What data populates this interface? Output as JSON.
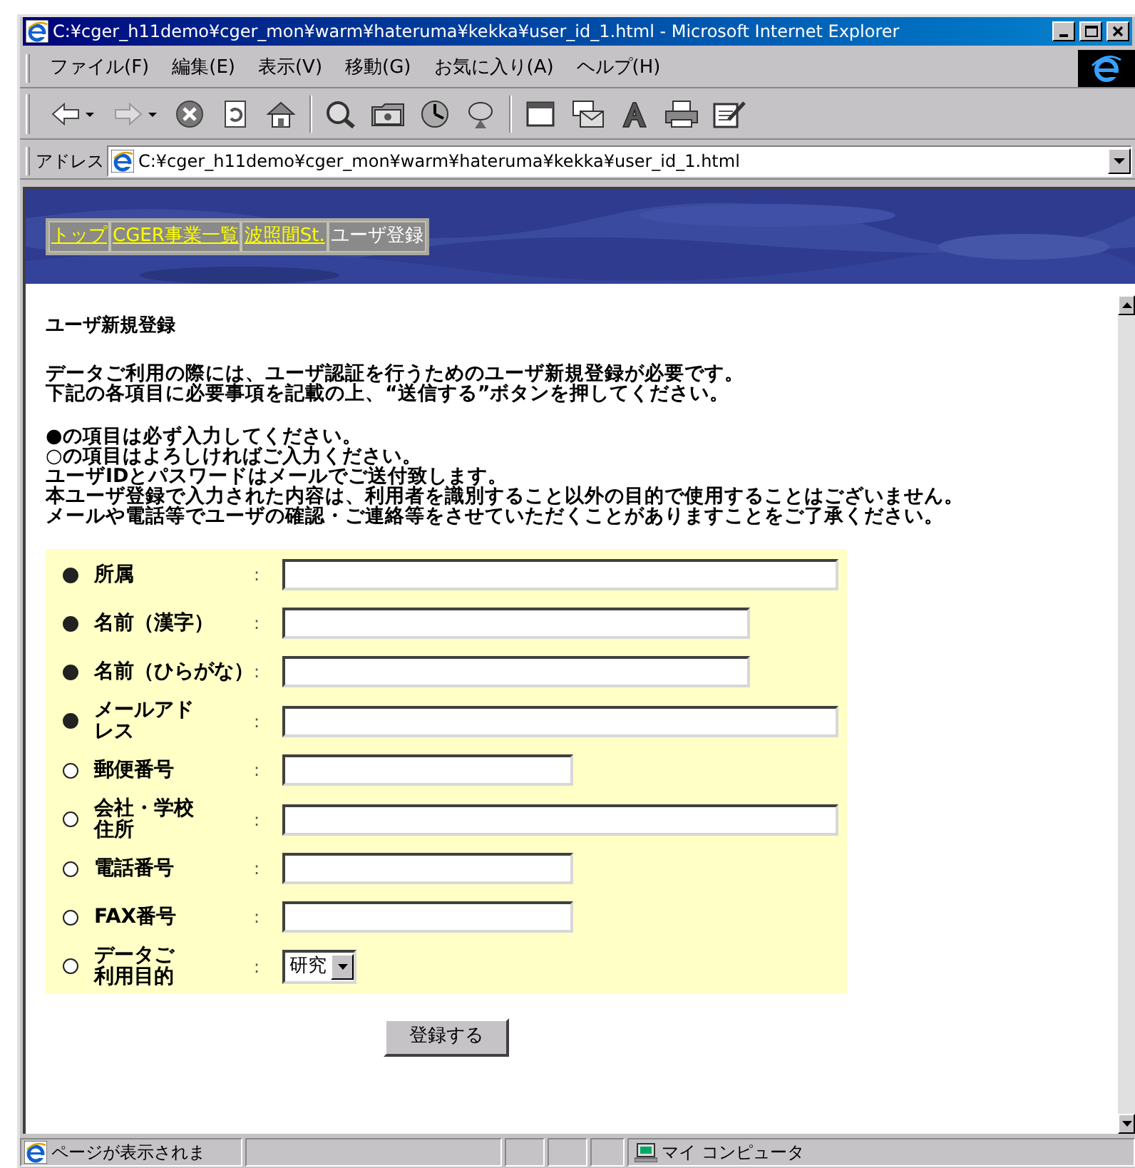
{
  "window": {
    "title": "C:¥cger_h11demo¥cger_mon¥warm¥hateruma¥kekka¥user_id_1.html - Microsoft Internet Explorer"
  },
  "menu": [
    "ファイル(F)",
    "編集(E)",
    "表示(V)",
    "移動(G)",
    "お気に入り(A)",
    "ヘルプ(H)"
  ],
  "toolbar": [
    {
      "kind": "back"
    },
    {
      "kind": "forward"
    },
    {
      "kind": "stop"
    },
    {
      "kind": "refresh"
    },
    {
      "kind": "home"
    },
    {
      "kind": "sep"
    },
    {
      "kind": "search"
    },
    {
      "kind": "favorites"
    },
    {
      "kind": "history"
    },
    {
      "kind": "channels"
    },
    {
      "kind": "sep"
    },
    {
      "kind": "fullscreen"
    },
    {
      "kind": "mail"
    },
    {
      "kind": "font"
    },
    {
      "kind": "print"
    },
    {
      "kind": "edit"
    }
  ],
  "address": {
    "label": "アドレス",
    "value": "C:¥cger_h11demo¥cger_mon¥warm¥hateruma¥kekka¥user_id_1.html"
  },
  "nav": [
    {
      "label": "トップ",
      "selected": false
    },
    {
      "label": "CGER事業一覧",
      "selected": false
    },
    {
      "label": "波照間St.",
      "selected": false
    },
    {
      "label": "ユーザ登録",
      "selected": true
    }
  ],
  "heading": "ユーザ新規登録",
  "paragraphs": [
    [
      "データご利用の際には、ユーザ認証を行うためのユーザ新規登録が必要です。",
      "下記の各項目に必要事項を記載の上、“送信する”ボタンを押してください。"
    ],
    [
      "●の項目は必ず入力してください。",
      "○の項目はよろしければご入力ください。",
      "ユーザIDとパスワードはメールでご送付致します。",
      "本ユーザ登録で入力された内容は、利用者を識別すること以外の目的で使用することはございません。",
      "メールや電話等でユーザの確認・ご連絡等をさせていただくことがありますことをご了承ください。"
    ]
  ],
  "form": [
    {
      "required": true,
      "label": "所属",
      "kind": "text"
    },
    {
      "required": true,
      "label": "名前（漢字）",
      "kind": "text"
    },
    {
      "required": true,
      "label": "名前（ひらがな）",
      "kind": "text"
    },
    {
      "required": true,
      "label": "メールアドレス",
      "kind": "text"
    },
    {
      "required": false,
      "label": "郵便番号",
      "kind": "text"
    },
    {
      "required": false,
      "label": "会社・学校住所",
      "kind": "text"
    },
    {
      "required": false,
      "label": "電話番号",
      "kind": "text"
    },
    {
      "required": false,
      "label": "FAX番号",
      "kind": "text"
    },
    {
      "required": false,
      "label": "データご利用目的",
      "kind": "select",
      "value": "研究"
    }
  ],
  "separator": ":",
  "submit": "登録する",
  "status_bar": {
    "text": "ページが表示されま",
    "zone": "マイ コンピュータ"
  }
}
